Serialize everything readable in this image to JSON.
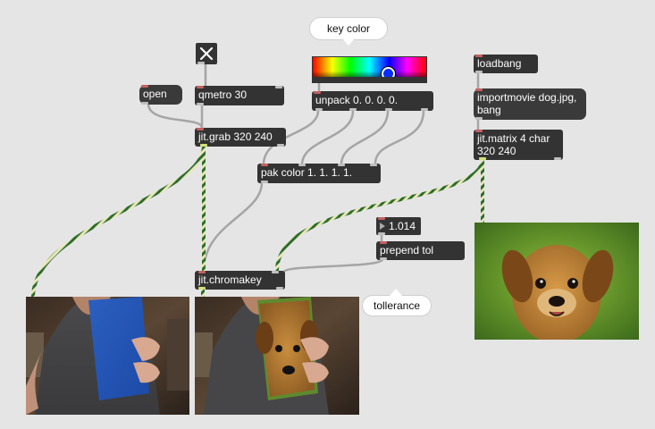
{
  "patcher": {
    "background": "#e5e5e5",
    "objects": {
      "toggle": {
        "state": "on"
      },
      "open_msg": {
        "label": "open"
      },
      "qmetro": {
        "label": "qmetro 30"
      },
      "jit_grab": {
        "label": "jit.grab 320 240"
      },
      "unpack": {
        "label": "unpack 0. 0. 0. 0."
      },
      "pak": {
        "label": "pak color 1. 1. 1. 1."
      },
      "chromakey": {
        "label": "jit.chromakey"
      },
      "loadbang": {
        "label": "loadbang"
      },
      "importmovie": {
        "label": "importmovie dog.jpg, bang"
      },
      "jit_matrix": {
        "label": "jit.matrix 4 char 320 240"
      },
      "number": {
        "value": "1.014"
      },
      "prepend": {
        "label": "prepend tol"
      },
      "swatch": {
        "picker": "color-picker",
        "selected_color": "#0a2bff"
      }
    },
    "comments": {
      "key_color": "key color",
      "tolerance": "tollerance"
    },
    "windows": {
      "grab_output": "jit.pwindow showing webcam image of person holding blue card",
      "chroma_output": "jit.pwindow showing keyed composite with dog over blue card",
      "matrix_output": "jit.pwindow showing dog photo"
    },
    "colors": {
      "object": "#333333",
      "matrix_cable_a": "#2d6b2d",
      "matrix_cable_b": "#e6e6b4",
      "control_cable": "#a5a5a5",
      "inlet_hot": "#c46060",
      "matrix_outlet": "#d6e07a"
    }
  }
}
